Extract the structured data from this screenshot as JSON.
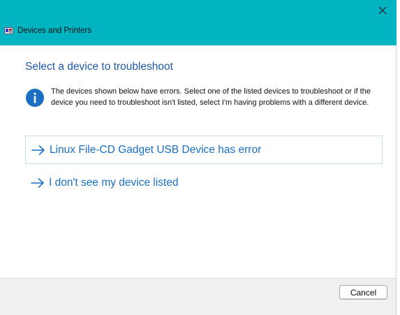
{
  "window": {
    "title": "Devices and Printers",
    "colors": {
      "titlebar": "#00b4c2",
      "heading": "#1f5aa6",
      "link": "#1a6fc2",
      "info_icon": "#1a6fc2",
      "option_border": "#c4dff0"
    }
  },
  "content": {
    "heading": "Select a device to troubleshoot",
    "info_text": "The devices shown below have errors. Select one of the listed devices to troubleshoot or if the device you need to troubleshoot isn't listed, select I'm having problems with a different device.",
    "options": [
      {
        "label": "Linux File-CD Gadget USB Device has error",
        "icon": "arrow-right-icon"
      },
      {
        "label": "I don't see my device listed",
        "icon": "arrow-right-icon"
      }
    ]
  },
  "footer": {
    "cancel_label": "Cancel"
  }
}
